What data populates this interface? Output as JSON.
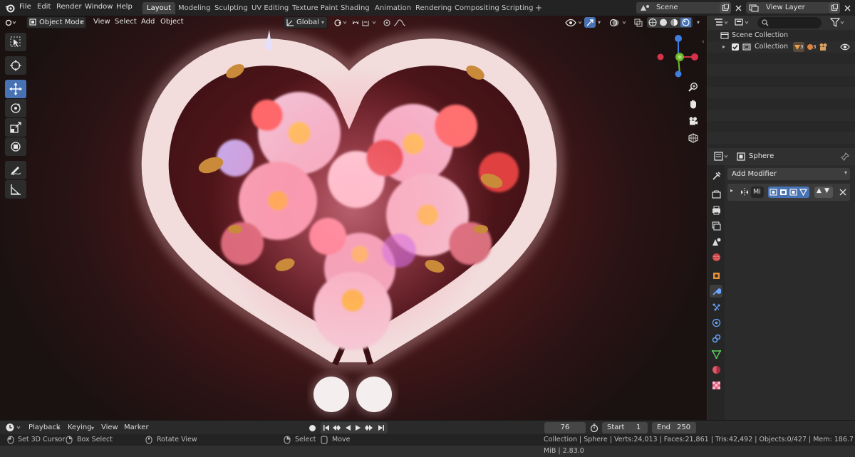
{
  "menu": {
    "file": "File",
    "edit": "Edit",
    "render": "Render",
    "window": "Window",
    "help": "Help"
  },
  "workspaces": [
    "Layout",
    "Modeling",
    "Sculpting",
    "UV Editing",
    "Texture Paint",
    "Shading",
    "Animation",
    "Rendering",
    "Compositing",
    "Scripting"
  ],
  "workspace_add": "+",
  "scene": {
    "name": "Scene"
  },
  "view_layer": {
    "name": "View Layer"
  },
  "viewport": {
    "mode": "Object Mode",
    "menus": {
      "view": "View",
      "select": "Select",
      "add": "Add",
      "object": "Object"
    },
    "transform_orientation": "Global"
  },
  "gizmo": {
    "x": "X",
    "y": "Y",
    "z": "Z"
  },
  "outliner": {
    "scene_collection": "Scene Collection",
    "collection": "Collection",
    "collection_counts": [
      "3",
      "3"
    ]
  },
  "properties": {
    "object_name": "Sphere",
    "add_modifier": "Add Modifier",
    "modifier_name": "Mi"
  },
  "timeline": {
    "menus": {
      "playback": "Playback",
      "keying": "Keying",
      "view": "View",
      "marker": "Marker"
    },
    "current_frame": "76",
    "start_label": "Start",
    "start": "1",
    "end_label": "End",
    "end": "250"
  },
  "statusbar": {
    "set_cursor": "Set 3D Cursor",
    "box_select": "Box Select",
    "rotate_view": "Rotate View",
    "select": "Select",
    "move": "Move",
    "stats": "Collection | Sphere | Verts:24,013 | Faces:21,861 | Tris:42,492 | Objects:0/427 | Mem: 186.7 MiB | 2.83.0"
  },
  "colors": {
    "accent": "#4772b3",
    "axis_x": "#d6324a",
    "axis_y": "#6cb82c",
    "axis_z": "#3f7de0"
  }
}
